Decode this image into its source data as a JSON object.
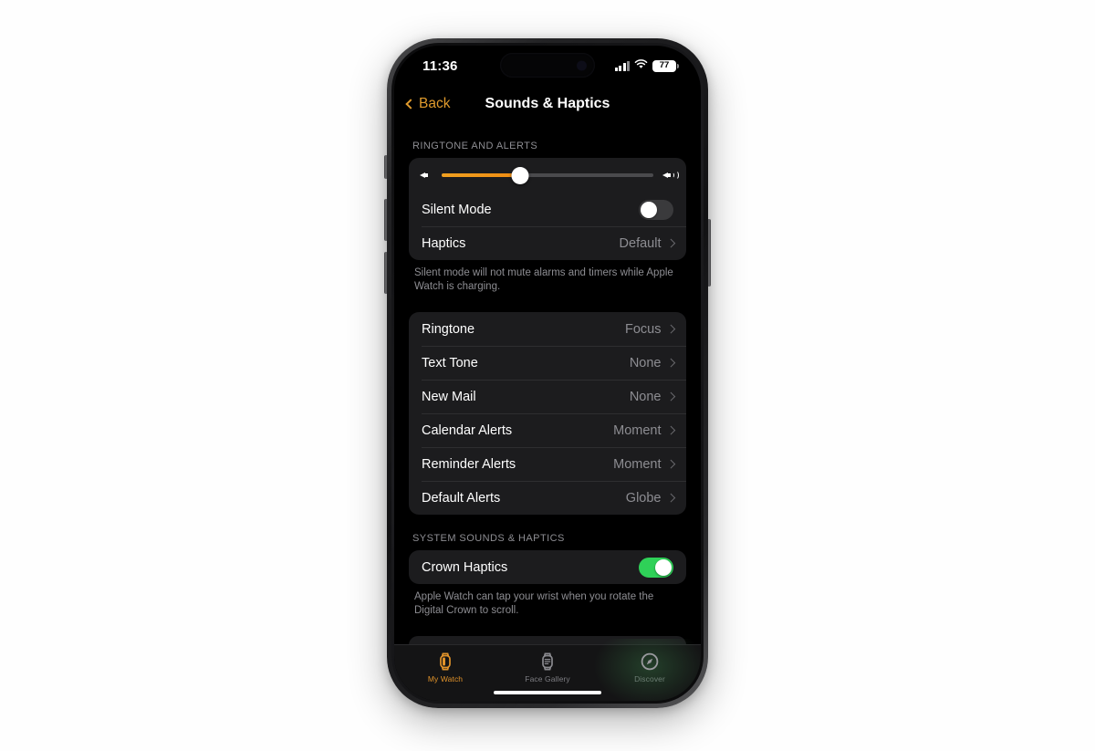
{
  "status_bar": {
    "time": "11:36",
    "battery_percent": "77",
    "cellular_icon": "cellular-bars-icon",
    "wifi_icon": "wifi-icon",
    "battery_icon": "battery-icon"
  },
  "nav": {
    "back_label": "Back",
    "back_icon": "chevron-left-icon",
    "title": "Sounds & Haptics"
  },
  "sections": [
    {
      "header": "RINGTONE AND ALERTS",
      "footnote": "Silent mode will not mute alarms and timers while Apple Watch is charging.",
      "volume_slider": {
        "name": "volume-slider",
        "value_percent": 37,
        "min_icon": "speaker-low-icon",
        "max_icon": "speaker-high-icon",
        "fill_color": "#f09018"
      },
      "rows": [
        {
          "label": "Silent Mode",
          "type": "toggle",
          "value": "off"
        },
        {
          "label": "Haptics",
          "type": "disclosure",
          "value": "Default"
        }
      ]
    },
    {
      "header": "",
      "footnote": "",
      "rows": [
        {
          "label": "Ringtone",
          "type": "disclosure",
          "value": "Focus"
        },
        {
          "label": "Text Tone",
          "type": "disclosure",
          "value": "None"
        },
        {
          "label": "New Mail",
          "type": "disclosure",
          "value": "None"
        },
        {
          "label": "Calendar Alerts",
          "type": "disclosure",
          "value": "Moment"
        },
        {
          "label": "Reminder Alerts",
          "type": "disclosure",
          "value": "Moment"
        },
        {
          "label": "Default Alerts",
          "type": "disclosure",
          "value": "Globe"
        }
      ]
    },
    {
      "header": "SYSTEM SOUNDS & HAPTICS",
      "footnote": "Apple Watch can tap your wrist when you rotate the Digital Crown to scroll.",
      "rows": [
        {
          "label": "Crown Haptics",
          "type": "toggle",
          "value": "on"
        }
      ]
    }
  ],
  "labels": {
    "sec1_header": "RINGTONE AND ALERTS",
    "sec1_footnote": "Silent mode will not mute alarms and timers while Apple Watch is charging.",
    "sec3_header": "SYSTEM SOUNDS & HAPTICS",
    "sec3_footnote": "Apple Watch can tap your wrist when you rotate the Digital Crown to scroll.",
    "silent_mode": "Silent Mode",
    "haptics": "Haptics",
    "haptics_value": "Default",
    "crown_haptics": "Crown Haptics"
  },
  "tab_bar": {
    "active": "My Watch",
    "tabs": [
      {
        "label": "My Watch",
        "icon": "apple-watch-icon",
        "active": true
      },
      {
        "label": "Face Gallery",
        "icon": "watch-face-icon",
        "active": false
      },
      {
        "label": "Discover",
        "icon": "compass-icon",
        "active": false
      }
    ]
  },
  "colors": {
    "accent": "#e0922a",
    "toggle_on": "#2fd158",
    "card": "#1c1c1e",
    "background": "#000000",
    "secondary_text": "#8d8d92"
  }
}
